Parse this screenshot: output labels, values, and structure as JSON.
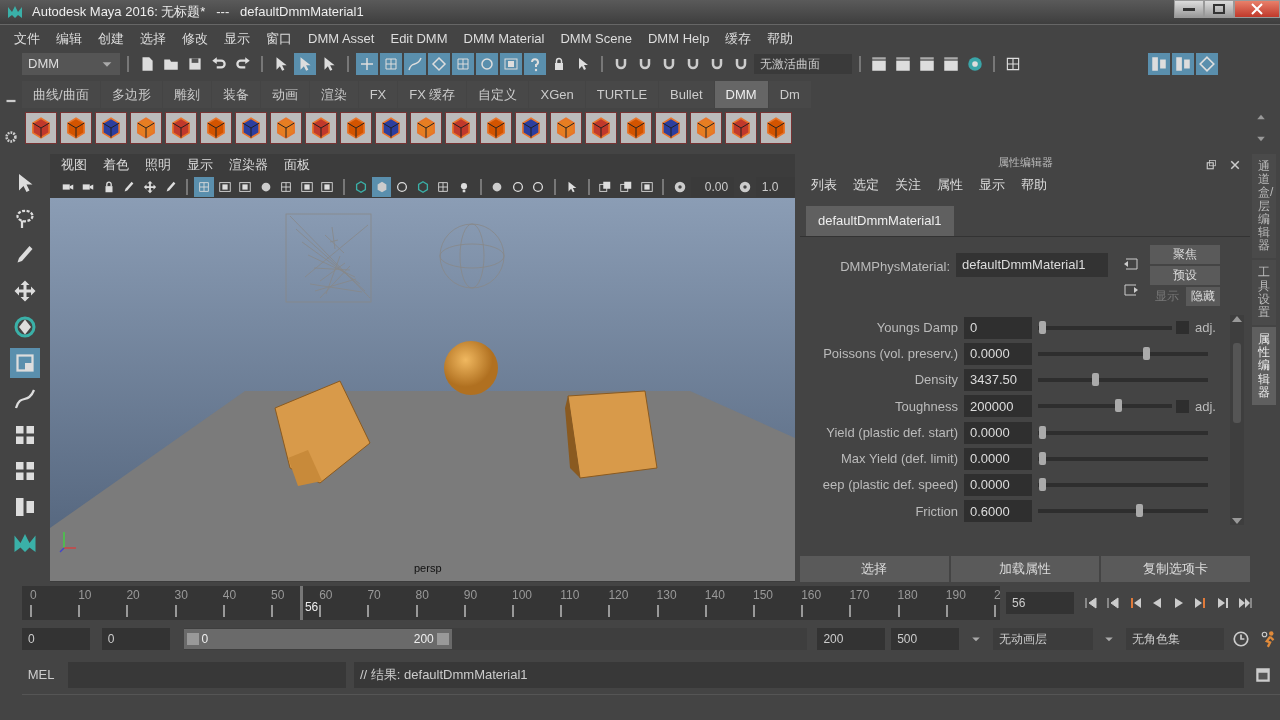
{
  "window": {
    "title": "Autodesk Maya 2016: 无标题*   ---   defaultDmmMaterial1"
  },
  "menus": [
    "文件",
    "编辑",
    "创建",
    "选择",
    "修改",
    "显示",
    "窗口",
    "DMM Asset",
    "Edit DMM",
    "DMM Material",
    "DMM Scene",
    "DMM Help",
    "缓存",
    "帮助"
  ],
  "toolbar": {
    "menu_set": "DMM",
    "surface_field": "无激活曲面"
  },
  "shelf_tabs": [
    {
      "label": "曲线/曲面",
      "selected": false
    },
    {
      "label": "多边形",
      "selected": false
    },
    {
      "label": "雕刻",
      "selected": false
    },
    {
      "label": "装备",
      "selected": false
    },
    {
      "label": "动画",
      "selected": false
    },
    {
      "label": "渲染",
      "selected": false
    },
    {
      "label": "FX",
      "selected": false
    },
    {
      "label": "FX 缓存",
      "selected": false
    },
    {
      "label": "自定义",
      "selected": false
    },
    {
      "label": "XGen",
      "selected": false
    },
    {
      "label": "TURTLE",
      "selected": false
    },
    {
      "label": "Bullet",
      "selected": false
    },
    {
      "label": "DMM",
      "selected": true
    },
    {
      "label": "Dm",
      "selected": false
    }
  ],
  "viewport": {
    "menus": [
      "视图",
      "着色",
      "照明",
      "显示",
      "渲染器",
      "面板"
    ],
    "near_value": "0.00",
    "far_value": "1.0",
    "camera_label": "persp"
  },
  "attribute_editor": {
    "title": "属性编辑器",
    "menus": [
      "列表",
      "选定",
      "关注",
      "属性",
      "显示",
      "帮助"
    ],
    "node_tab": {
      "label": "defaultDmmMaterial1",
      "selected": true
    },
    "node_type_label": "DMMPhysMaterial:",
    "node_name": "defaultDmmMaterial1",
    "side_buttons": [
      "聚焦",
      "预设"
    ],
    "show_label": "显示",
    "hide_label": "隐藏",
    "attributes": [
      {
        "label": "Youngs Damp",
        "value": "0",
        "level": 0,
        "adj_label": "adj.",
        "adj_checked": false
      },
      {
        "label": "Poissons (vol. preserv.)",
        "value": "0.0000",
        "level": 0.64
      },
      {
        "label": "Density",
        "value": "3437.50",
        "level": 0.33
      },
      {
        "label": "Toughness",
        "value": "200000",
        "level": 0.6,
        "adj_label": "adj.",
        "adj_checked": false
      },
      {
        "label": "Yield (plastic def. start)",
        "value": "0.0000",
        "level": 0
      },
      {
        "label": "Max Yield (def. limit)",
        "value": "0.0000",
        "level": 0
      },
      {
        "label": "eep (plastic def. speed)",
        "value": "0.0000",
        "level": 0
      },
      {
        "label": "Friction",
        "value": "0.6000",
        "level": 0.6
      }
    ],
    "bottom_buttons": [
      "选择",
      "加载属性",
      "复制选项卡"
    ]
  },
  "side_tabs": [
    {
      "label": "通道盒/层编辑器",
      "selected": false
    },
    {
      "label": "工具设置",
      "selected": false
    },
    {
      "label": "属性编辑器",
      "selected": true
    }
  ],
  "timeline": {
    "ticks": [
      "0",
      "10",
      "20",
      "30",
      "40",
      "50",
      "60",
      "70",
      "80",
      "90",
      "100",
      "110",
      "120",
      "130",
      "140",
      "150",
      "160",
      "170",
      "180",
      "190",
      "2"
    ],
    "current_frame": "56",
    "level": 0.28,
    "frame_field": "56"
  },
  "range": {
    "level": 0.43,
    "start": "0",
    "playback_start": "0",
    "slider_start": "0",
    "slider_end": "200",
    "playback_end": "200",
    "end": "500",
    "anim_layer": "无动画层",
    "character_set": "无角色集"
  },
  "command_line": {
    "language": "MEL",
    "result": "// 结果: defaultDmmMaterial1"
  }
}
